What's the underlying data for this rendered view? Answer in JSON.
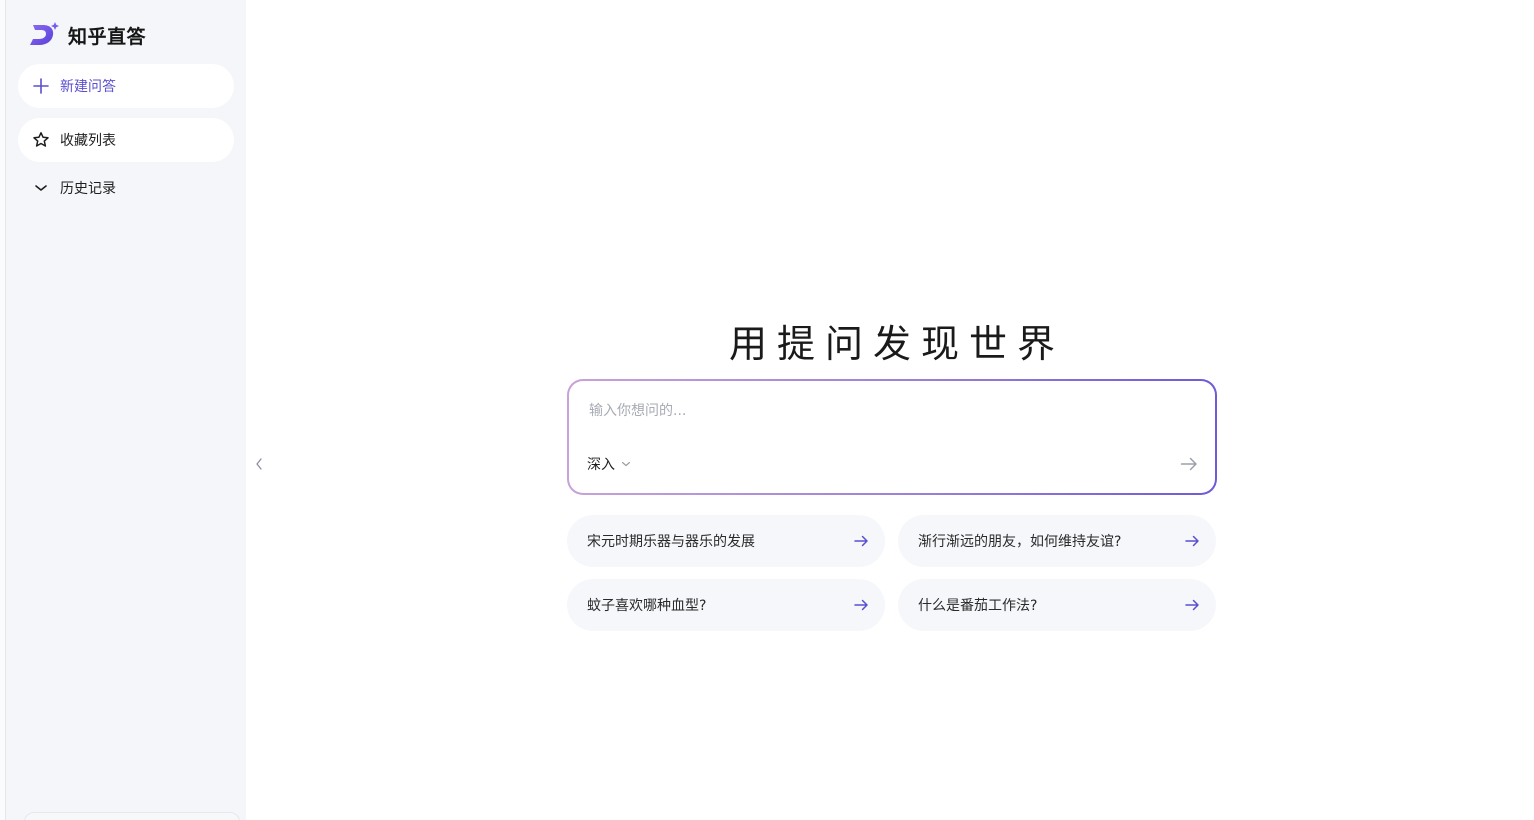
{
  "app": {
    "name": "知乎直答"
  },
  "sidebar": {
    "new_question": "新建问答",
    "favorites": "收藏列表",
    "history": "历史记录"
  },
  "main": {
    "title": "用提问发现世界",
    "input_placeholder": "输入你想问的...",
    "mode_label": "深入",
    "suggestions": [
      "宋元时期乐器与器乐的发展",
      "渐行渐远的朋友，如何维持友谊?",
      "蚊子喜欢哪种血型?",
      "什么是番茄工作法?"
    ]
  },
  "colors": {
    "accent": "#5a4fcf",
    "sidebar_bg": "#f4f6f9",
    "suggestion_bg": "#f5f7fa",
    "input_border_start": "#c9a2d8",
    "input_border_end": "#6f5ad8"
  },
  "icons": {
    "brand": "zhida-logo-icon",
    "new": "plus-icon",
    "favorites": "star-icon",
    "history": "chevron-down-icon",
    "collapse": "chevron-left-icon",
    "send": "arrow-right-icon",
    "suggestion": "arrow-right-icon"
  }
}
